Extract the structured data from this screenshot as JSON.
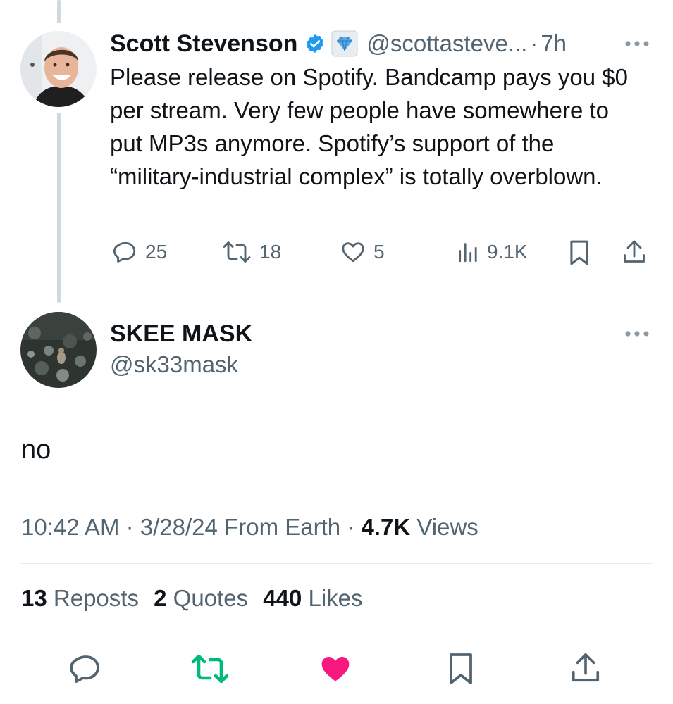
{
  "parent_tweet": {
    "author_name": "Scott Stevenson",
    "handle": "@scottasteve...",
    "separator": "·",
    "time_ago": "7h",
    "text": "Please release on Spotify. Bandcamp pays you $0 per stream. Very few people have somewhere to put MP3s anymore. Spotify’s support of the “military-industrial complex” is totally overblown.",
    "actions": {
      "replies": "25",
      "reposts": "18",
      "likes": "5",
      "views": "9.1K"
    }
  },
  "reply_tweet": {
    "author_name": "SKEE MASK",
    "handle": "@sk33mask",
    "text": "no",
    "meta": {
      "time": "10:42 AM",
      "sep1": "·",
      "date": "3/28/24",
      "source": "From Earth",
      "sep2": "·",
      "views_count": "4.7K",
      "views_label": "Views"
    },
    "stats": {
      "reposts_count": "13",
      "reposts_label": "Reposts",
      "quotes_count": "2",
      "quotes_label": "Quotes",
      "likes_count": "440",
      "likes_label": "Likes"
    }
  },
  "colors": {
    "verified": "#1d9bf0",
    "repost_active": "#00ba7c",
    "like_active": "#f91880",
    "muted": "#536471"
  },
  "icons": {
    "reply": "speech-bubble-icon",
    "repost": "repost-arrows-icon",
    "like": "heart-icon",
    "views": "bar-chart-icon",
    "bookmark": "bookmark-icon",
    "share": "share-upload-icon",
    "more": "more-dots-icon",
    "verified": "verified-badge-icon",
    "affiliate": "diamond-badge-icon"
  }
}
